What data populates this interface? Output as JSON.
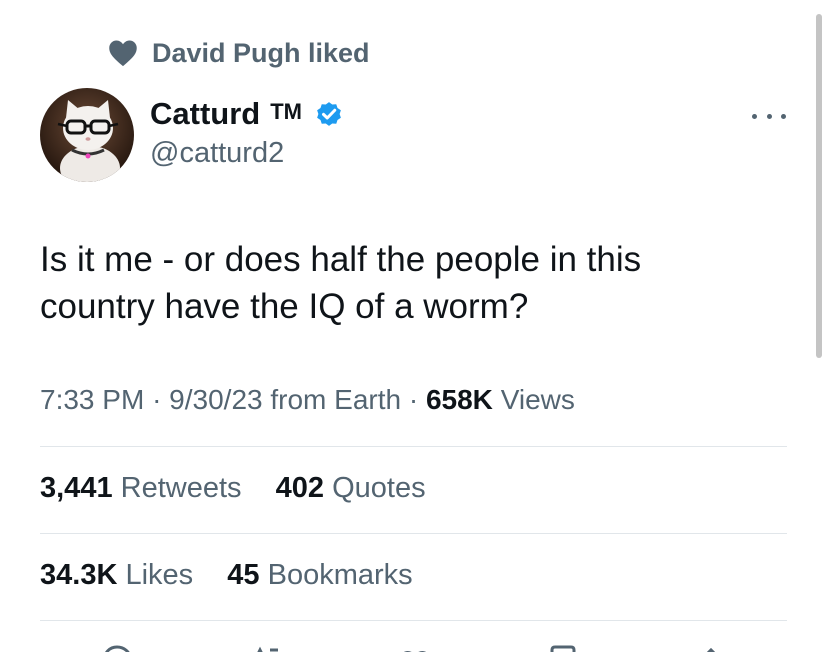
{
  "social_context": {
    "text": "David Pugh liked",
    "icon": "heart-icon"
  },
  "author": {
    "display_name": "Catturd",
    "badge_text": "TM",
    "verified": true,
    "handle": "@catturd2",
    "avatar": "cat-with-glasses-avatar"
  },
  "tweet": {
    "text_line1": "Is it me - or does half the people in this",
    "text_line2": "country have the IQ of a worm?"
  },
  "meta": {
    "time": "7:33 PM",
    "date": "9/30/23",
    "source": "from Earth",
    "sep": "·",
    "views_count": "658K",
    "views_label": "Views"
  },
  "engagement": {
    "retweets_count": "3,441",
    "retweets_label": "Retweets",
    "quotes_count": "402",
    "quotes_label": "Quotes",
    "likes_count": "34.3K",
    "likes_label": "Likes",
    "bookmarks_count": "45",
    "bookmarks_label": "Bookmarks"
  },
  "colors": {
    "text_primary": "#0f1419",
    "text_secondary": "#536471",
    "verified_blue": "#1d9bf0",
    "divider": "#e1e6ea"
  }
}
